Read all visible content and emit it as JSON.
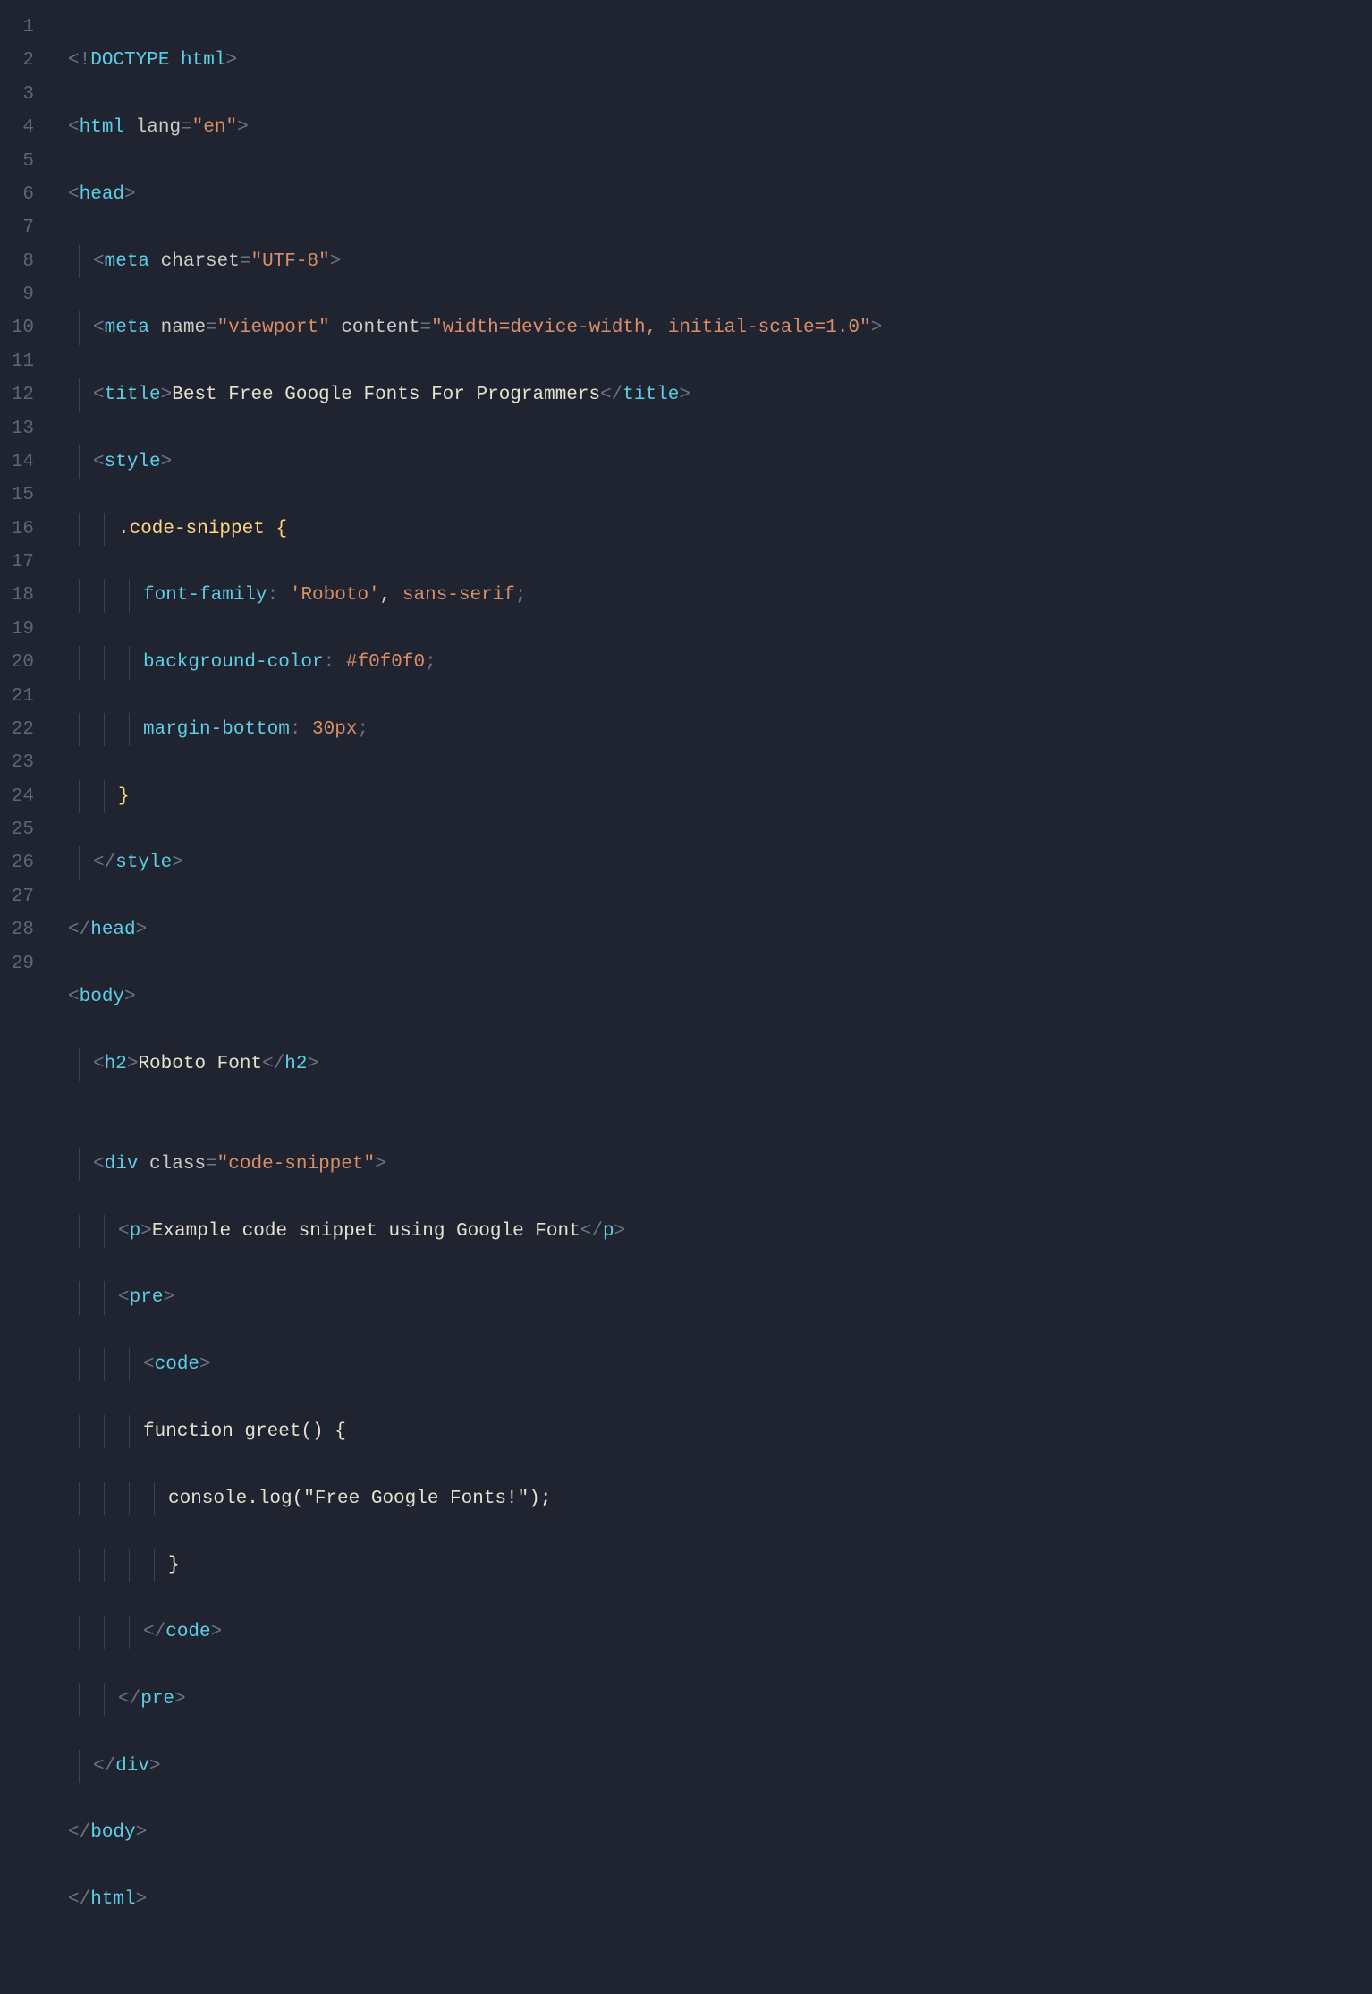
{
  "lines": {
    "count": 29,
    "l1": {
      "punc_open": "<!",
      "doctype_kw": "DOCTYPE",
      "sp": " ",
      "doctype_val": "html",
      "punc_close": ">"
    },
    "l2": {
      "open": "<",
      "tag": "html",
      "sp": " ",
      "attr": "lang",
      "eq": "=",
      "val": "\"en\"",
      "close": ">"
    },
    "l3": {
      "open": "<",
      "tag": "head",
      "close": ">"
    },
    "l4": {
      "open": "<",
      "tag": "meta",
      "sp": " ",
      "attr": "charset",
      "eq": "=",
      "val": "\"UTF-8\"",
      "close": ">"
    },
    "l5": {
      "open": "<",
      "tag": "meta",
      "sp1": " ",
      "attr1": "name",
      "eq1": "=",
      "val1": "\"viewport\"",
      "sp2": " ",
      "attr2": "content",
      "eq2": "=",
      "val2": "\"width=device-width, initial-scale=1.0\"",
      "close": ">"
    },
    "l6": {
      "open": "<",
      "tag_open": "title",
      "close1": ">",
      "text": "Best Free Google Fonts For Programmers",
      "open2": "</",
      "tag_close": "title",
      "close2": ">"
    },
    "l7": {
      "open": "<",
      "tag": "style",
      "close": ">"
    },
    "l8": {
      "selector": ".code-snippet",
      "sp": " ",
      "brace": "{"
    },
    "l9": {
      "prop": "font-family",
      "colon": ":",
      "sp": " ",
      "val1": "'Roboto'",
      "comma": ",",
      "sp2": " ",
      "val2": "sans-serif",
      "semi": ";"
    },
    "l10": {
      "prop": "background-color",
      "colon": ":",
      "sp": " ",
      "val": "#f0f0f0",
      "semi": ";"
    },
    "l11": {
      "prop": "margin-bottom",
      "colon": ":",
      "sp": " ",
      "val": "30px",
      "semi": ";"
    },
    "l12": {
      "brace": "}"
    },
    "l13": {
      "open": "</",
      "tag": "style",
      "close": ">"
    },
    "l14": {
      "open": "</",
      "tag": "head",
      "close": ">"
    },
    "l15": {
      "open": "<",
      "tag": "body",
      "close": ">"
    },
    "l16": {
      "open": "<",
      "tag_open": "h2",
      "close1": ">",
      "text": "Roboto Font",
      "open2": "</",
      "tag_close": "h2",
      "close2": ">"
    },
    "l17": {
      "blank": ""
    },
    "l18": {
      "open": "<",
      "tag": "div",
      "sp": " ",
      "attr": "class",
      "eq": "=",
      "val": "\"code-snippet\"",
      "close": ">"
    },
    "l19": {
      "open": "<",
      "tag_open": "p",
      "close1": ">",
      "text": "Example code snippet using Google Font",
      "open2": "</",
      "tag_close": "p",
      "close2": ">"
    },
    "l20": {
      "open": "<",
      "tag": "pre",
      "close": ">"
    },
    "l21": {
      "open": "<",
      "tag": "code",
      "close": ">"
    },
    "l22": {
      "text": "function greet() {"
    },
    "l23": {
      "text": "console.log(\"Free Google Fonts!\");"
    },
    "l24": {
      "text": "}"
    },
    "l25": {
      "open": "</",
      "tag": "code",
      "close": ">"
    },
    "l26": {
      "open": "</",
      "tag": "pre",
      "close": ">"
    },
    "l27": {
      "open": "</",
      "tag": "div",
      "close": ">"
    },
    "l28": {
      "open": "</",
      "tag": "body",
      "close": ">"
    },
    "l29": {
      "open": "</",
      "tag": "html",
      "close": ">"
    }
  }
}
